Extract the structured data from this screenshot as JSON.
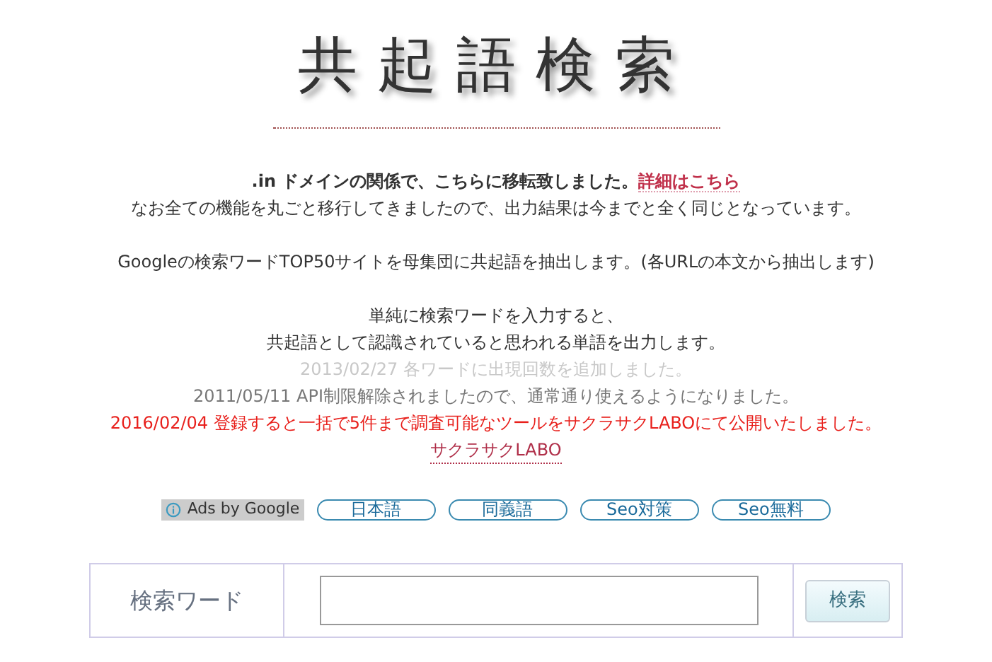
{
  "logo": "共起語検索",
  "notice": {
    "text": ".in ドメインの関係で、こちらに移転致しました。",
    "link": "詳細はこちら"
  },
  "paragraphs": [
    {
      "lines": [
        {
          "kind": "normal",
          "text": "なお全ての機能を丸ごと移行してきましたので、出力結果は今までと全く同じとなっています。"
        }
      ]
    },
    {
      "lines": [
        {
          "kind": "normal",
          "text": "Googleの検索ワードTOP50サイトを母集団に共起語を抽出します。(各URLの本文から抽出します)"
        }
      ]
    },
    {
      "lines": [
        {
          "kind": "normal",
          "text": "単純に検索ワードを入力すると、"
        },
        {
          "kind": "normal",
          "text": "共起語として認識されていると思われる単語を出力します。"
        },
        {
          "kind": "faded",
          "text": "2013/02/27 各ワードに出現回数を追加しました。"
        },
        {
          "kind": "muted",
          "text": "2011/05/11 API制限解除されましたので、通常通り使えるようになりました。"
        },
        {
          "kind": "alert",
          "text": "2016/02/04 登録すると一括で5件まで調査可能なツールをサクラサクLABOにて公開いたしました。"
        },
        {
          "kind": "link",
          "text": "サクラサクLABO"
        }
      ]
    }
  ],
  "ads": {
    "label": "Ads by Google",
    "links": [
      "日本語",
      "同義語",
      "Seo対策",
      "Seo無料"
    ]
  },
  "search": {
    "label": "検索ワード",
    "button": "検索"
  }
}
